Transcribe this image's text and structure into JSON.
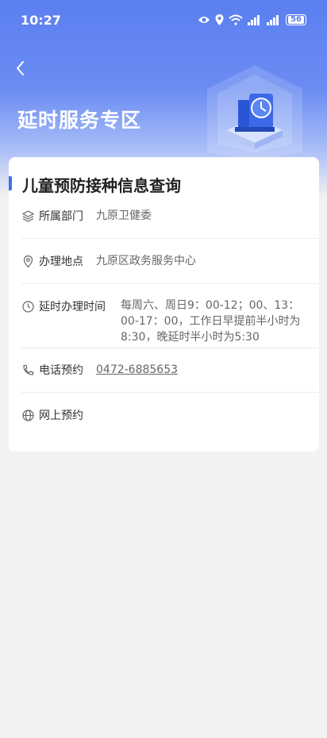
{
  "status_bar": {
    "time": "10:27",
    "battery": "56"
  },
  "header": {
    "title": "延时服务专区"
  },
  "card": {
    "title": "儿童预防接种信息查询",
    "rows": [
      {
        "label": "所属部门",
        "value": "九原卫健委",
        "icon": "layers-icon"
      },
      {
        "label": "办理地点",
        "value": "九原区政务服务中心",
        "icon": "location-icon"
      },
      {
        "label": "延时办理时间",
        "value": "每周六、周日9：00-12；00、13：00-17：00，工作日早提前半小时为8:30，晚延时半小时为5:30",
        "icon": "clock-icon"
      },
      {
        "label": "电话预约",
        "value": "0472-6885653",
        "icon": "phone-icon"
      },
      {
        "label": "网上预约",
        "value": "",
        "icon": "globe-icon"
      }
    ]
  },
  "colors": {
    "header_blue": "#5b7ff0",
    "accent": "#3f72e8",
    "link": "#1a3fc6"
  }
}
